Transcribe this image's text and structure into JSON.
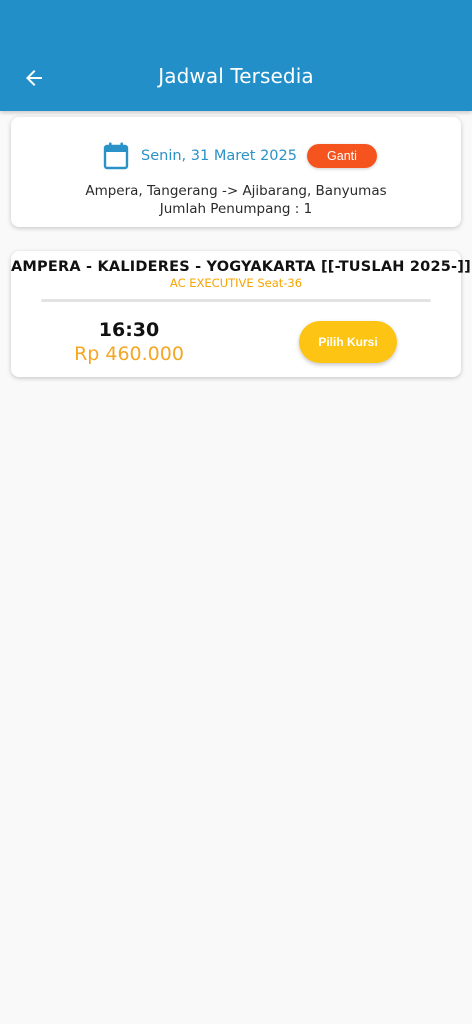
{
  "app_bar": {
    "title": "Jadwal Tersedia",
    "back_icon": "arrow-left-icon",
    "background_color": "#238fc9"
  },
  "search_summary": {
    "calendar_icon": "calendar-icon",
    "date": "Senin, 31 Maret 2025",
    "change_label": "Ganti",
    "route": "Ampera, Tangerang -> Ajibarang, Banyumas",
    "passengers": "Jumlah Penumpang : 1"
  },
  "schedules": [
    {
      "route_name": "AMPERA - KALIDERES - YOGYAKARTA [[-TUSLAH 2025-]]",
      "bus_class": "AC EXECUTIVE Seat-36",
      "departure_time": "16:30",
      "price": "Rp 460.000",
      "select_seat_label": "Pilih Kursi"
    }
  ],
  "colors": {
    "primary": "#238fc9",
    "change_button": "#f6541f",
    "accent_orange": "#f5a623",
    "select_button": "#fdc414"
  }
}
